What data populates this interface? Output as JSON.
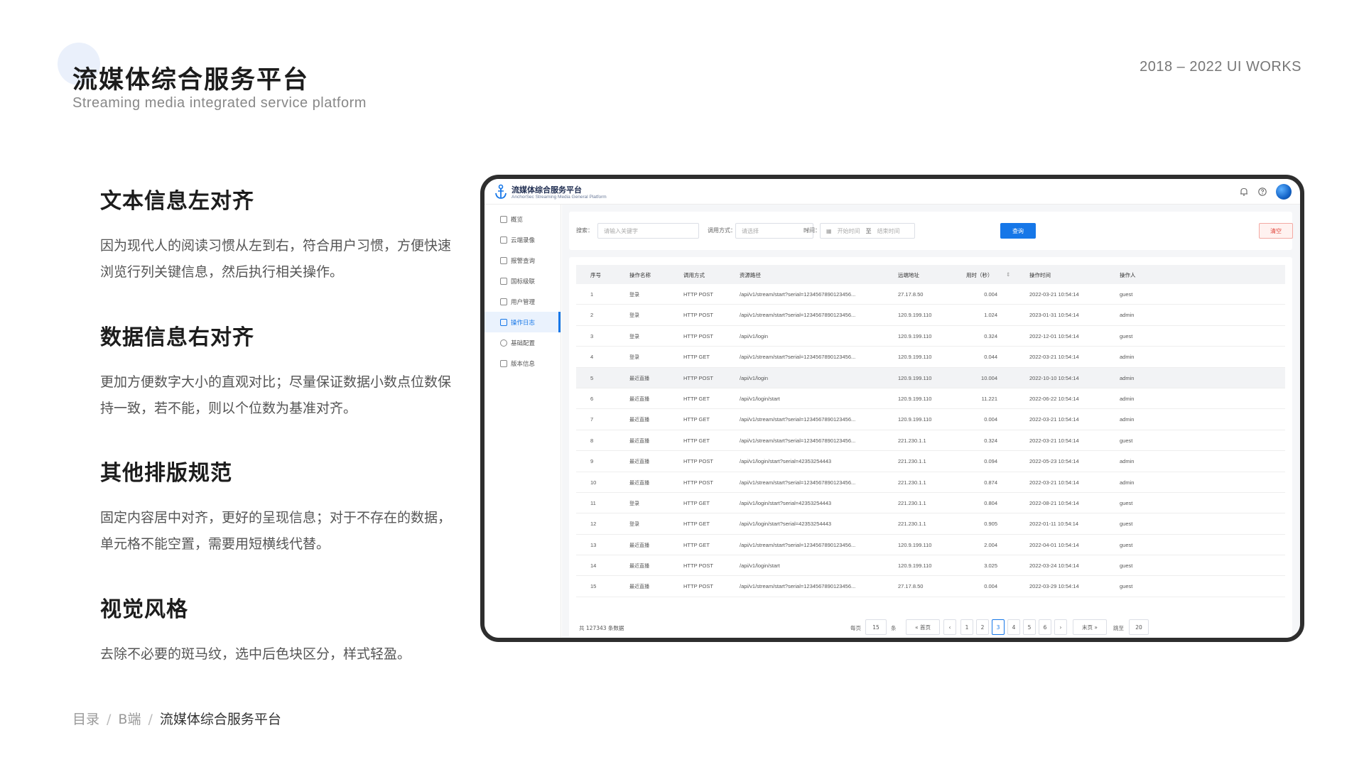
{
  "header": {
    "title": "流媒体综合服务平台",
    "subtitle": "Streaming media integrated service platform",
    "works": "2018 – 2022 UI WORKS"
  },
  "sections": [
    {
      "title": "文本信息左对齐",
      "body": "因为现代人的阅读习惯从左到右，符合用户习惯，方便快速浏览行列关键信息，然后执行相关操作。"
    },
    {
      "title": "数据信息右对齐",
      "body": "更加方便数字大小的直观对比；尽量保证数据小数点位数保持一致，若不能，则以个位数为基准对齐。"
    },
    {
      "title": "其他排版规范",
      "body": "固定内容居中对齐，更好的呈现信息；对于不存在的数据，单元格不能空置，需要用短横线代替。"
    },
    {
      "title": "视觉风格",
      "body": "去除不必要的斑马纹，选中后色块区分，样式轻盈。"
    }
  ],
  "breadcrumb": {
    "items": [
      "目录",
      "B端"
    ],
    "current": "流媒体综合服务平台"
  },
  "app": {
    "name": "流媒体综合服务平台",
    "subname": "AnchorSec Streaming Media General Platform",
    "icons": [
      "bell-icon",
      "help-icon"
    ],
    "menu": [
      {
        "label": "概览",
        "active": false
      },
      {
        "label": "云端录像",
        "active": false
      },
      {
        "label": "报警查询",
        "active": false
      },
      {
        "label": "国标级联",
        "active": false
      },
      {
        "label": "用户管理",
        "active": false
      },
      {
        "label": "操作日志",
        "active": true
      },
      {
        "label": "基础配置",
        "active": false
      },
      {
        "label": "版本信息",
        "active": false
      }
    ],
    "filters": {
      "search_label": "搜索：",
      "search_placeholder": "请输入关键字",
      "method_label": "调用方式：",
      "method_placeholder": "请选择",
      "time_label": "时间：",
      "start_placeholder": "开始时间",
      "to_label": "至",
      "end_placeholder": "结束时间",
      "query_label": "查询",
      "clear_label": "清空"
    },
    "table": {
      "columns": [
        "序号",
        "操作名称",
        "调用方式",
        "资源路径",
        "远端地址",
        "用时（秒）",
        "操作时间",
        "操作人"
      ],
      "rows": [
        [
          "1",
          "登录",
          "HTTP POST",
          "/api/v1/stream/start?serial=1234567890123456...",
          "27.17.8.50",
          "0.004",
          "2022-03-21 10:54:14",
          "guest"
        ],
        [
          "2",
          "登录",
          "HTTP POST",
          "/api/v1/stream/start?serial=1234567890123456...",
          "120.9.199.110",
          "1.024",
          "2023-01-31 10:54:14",
          "admin"
        ],
        [
          "3",
          "登录",
          "HTTP POST",
          "/api/v1/login",
          "120.9.199.110",
          "0.324",
          "2022-12-01 10:54:14",
          "guest"
        ],
        [
          "4",
          "登录",
          "HTTP GET",
          "/api/v1/stream/start?serial=1234567890123456...",
          "120.9.199.110",
          "0.044",
          "2022-03-21 10:54:14",
          "admin"
        ],
        [
          "5",
          "最近直播",
          "HTTP POST",
          "/api/v1/login",
          "120.9.199.110",
          "10.004",
          "2022-10-10 10:54:14",
          "admin"
        ],
        [
          "6",
          "最近直播",
          "HTTP GET",
          "/api/v1/login/start",
          "120.9.199.110",
          "11.221",
          "2022-06-22 10:54:14",
          "admin"
        ],
        [
          "7",
          "最近直播",
          "HTTP GET",
          "/api/v1/stream/start?serial=1234567890123456...",
          "120.9.199.110",
          "0.004",
          "2022-03-21 10:54:14",
          "admin"
        ],
        [
          "8",
          "最近直播",
          "HTTP GET",
          "/api/v1/stream/start?serial=1234567890123456...",
          "221.230.1.1",
          "0.324",
          "2022-03-21 10:54:14",
          "guest"
        ],
        [
          "9",
          "最近直播",
          "HTTP POST",
          "/api/v1/login/start?serial=42353254443",
          "221.230.1.1",
          "0.094",
          "2022-05-23 10:54:14",
          "admin"
        ],
        [
          "10",
          "最近直播",
          "HTTP POST",
          "/api/v1/stream/start?serial=1234567890123456...",
          "221.230.1.1",
          "0.874",
          "2022-03-21 10:54:14",
          "admin"
        ],
        [
          "11",
          "登录",
          "HTTP GET",
          "/api/v1/login/start?serial=42353254443",
          "221.230.1.1",
          "0.804",
          "2022-08-21 10:54:14",
          "guest"
        ],
        [
          "12",
          "登录",
          "HTTP GET",
          "/api/v1/login/start?serial=42353254443",
          "221.230.1.1",
          "0.905",
          "2022-01-11 10:54:14",
          "guest"
        ],
        [
          "13",
          "最近直播",
          "HTTP GET",
          "/api/v1/stream/start?serial=1234567890123456...",
          "120.9.199.110",
          "2.004",
          "2022-04-01 10:54:14",
          "guest"
        ],
        [
          "14",
          "最近直播",
          "HTTP POST",
          "/api/v1/login/start",
          "120.9.199.110",
          "3.025",
          "2022-03-24 10:54:14",
          "guest"
        ],
        [
          "15",
          "最近直播",
          "HTTP POST",
          "/api/v1/stream/start?serial=1234567890123456...",
          "27.17.8.50",
          "0.004",
          "2022-03-29 10:54:14",
          "guest"
        ]
      ],
      "selected_row": 5
    },
    "pagination": {
      "total": "共 127343 条数据",
      "per_page_label": "每页",
      "per_page": "15",
      "per_page_unit": "条",
      "first_label": "« 首页",
      "prev": "‹",
      "pages": [
        "1",
        "2",
        "3",
        "4",
        "5",
        "6"
      ],
      "current": "3",
      "next": "›",
      "last_label": "末页 »",
      "goto_label": "跳至",
      "goto_value": "20"
    }
  },
  "colors": {
    "accent": "#1677e8",
    "danger": "#e0463c",
    "selected_bg": "#eaf2fd"
  }
}
